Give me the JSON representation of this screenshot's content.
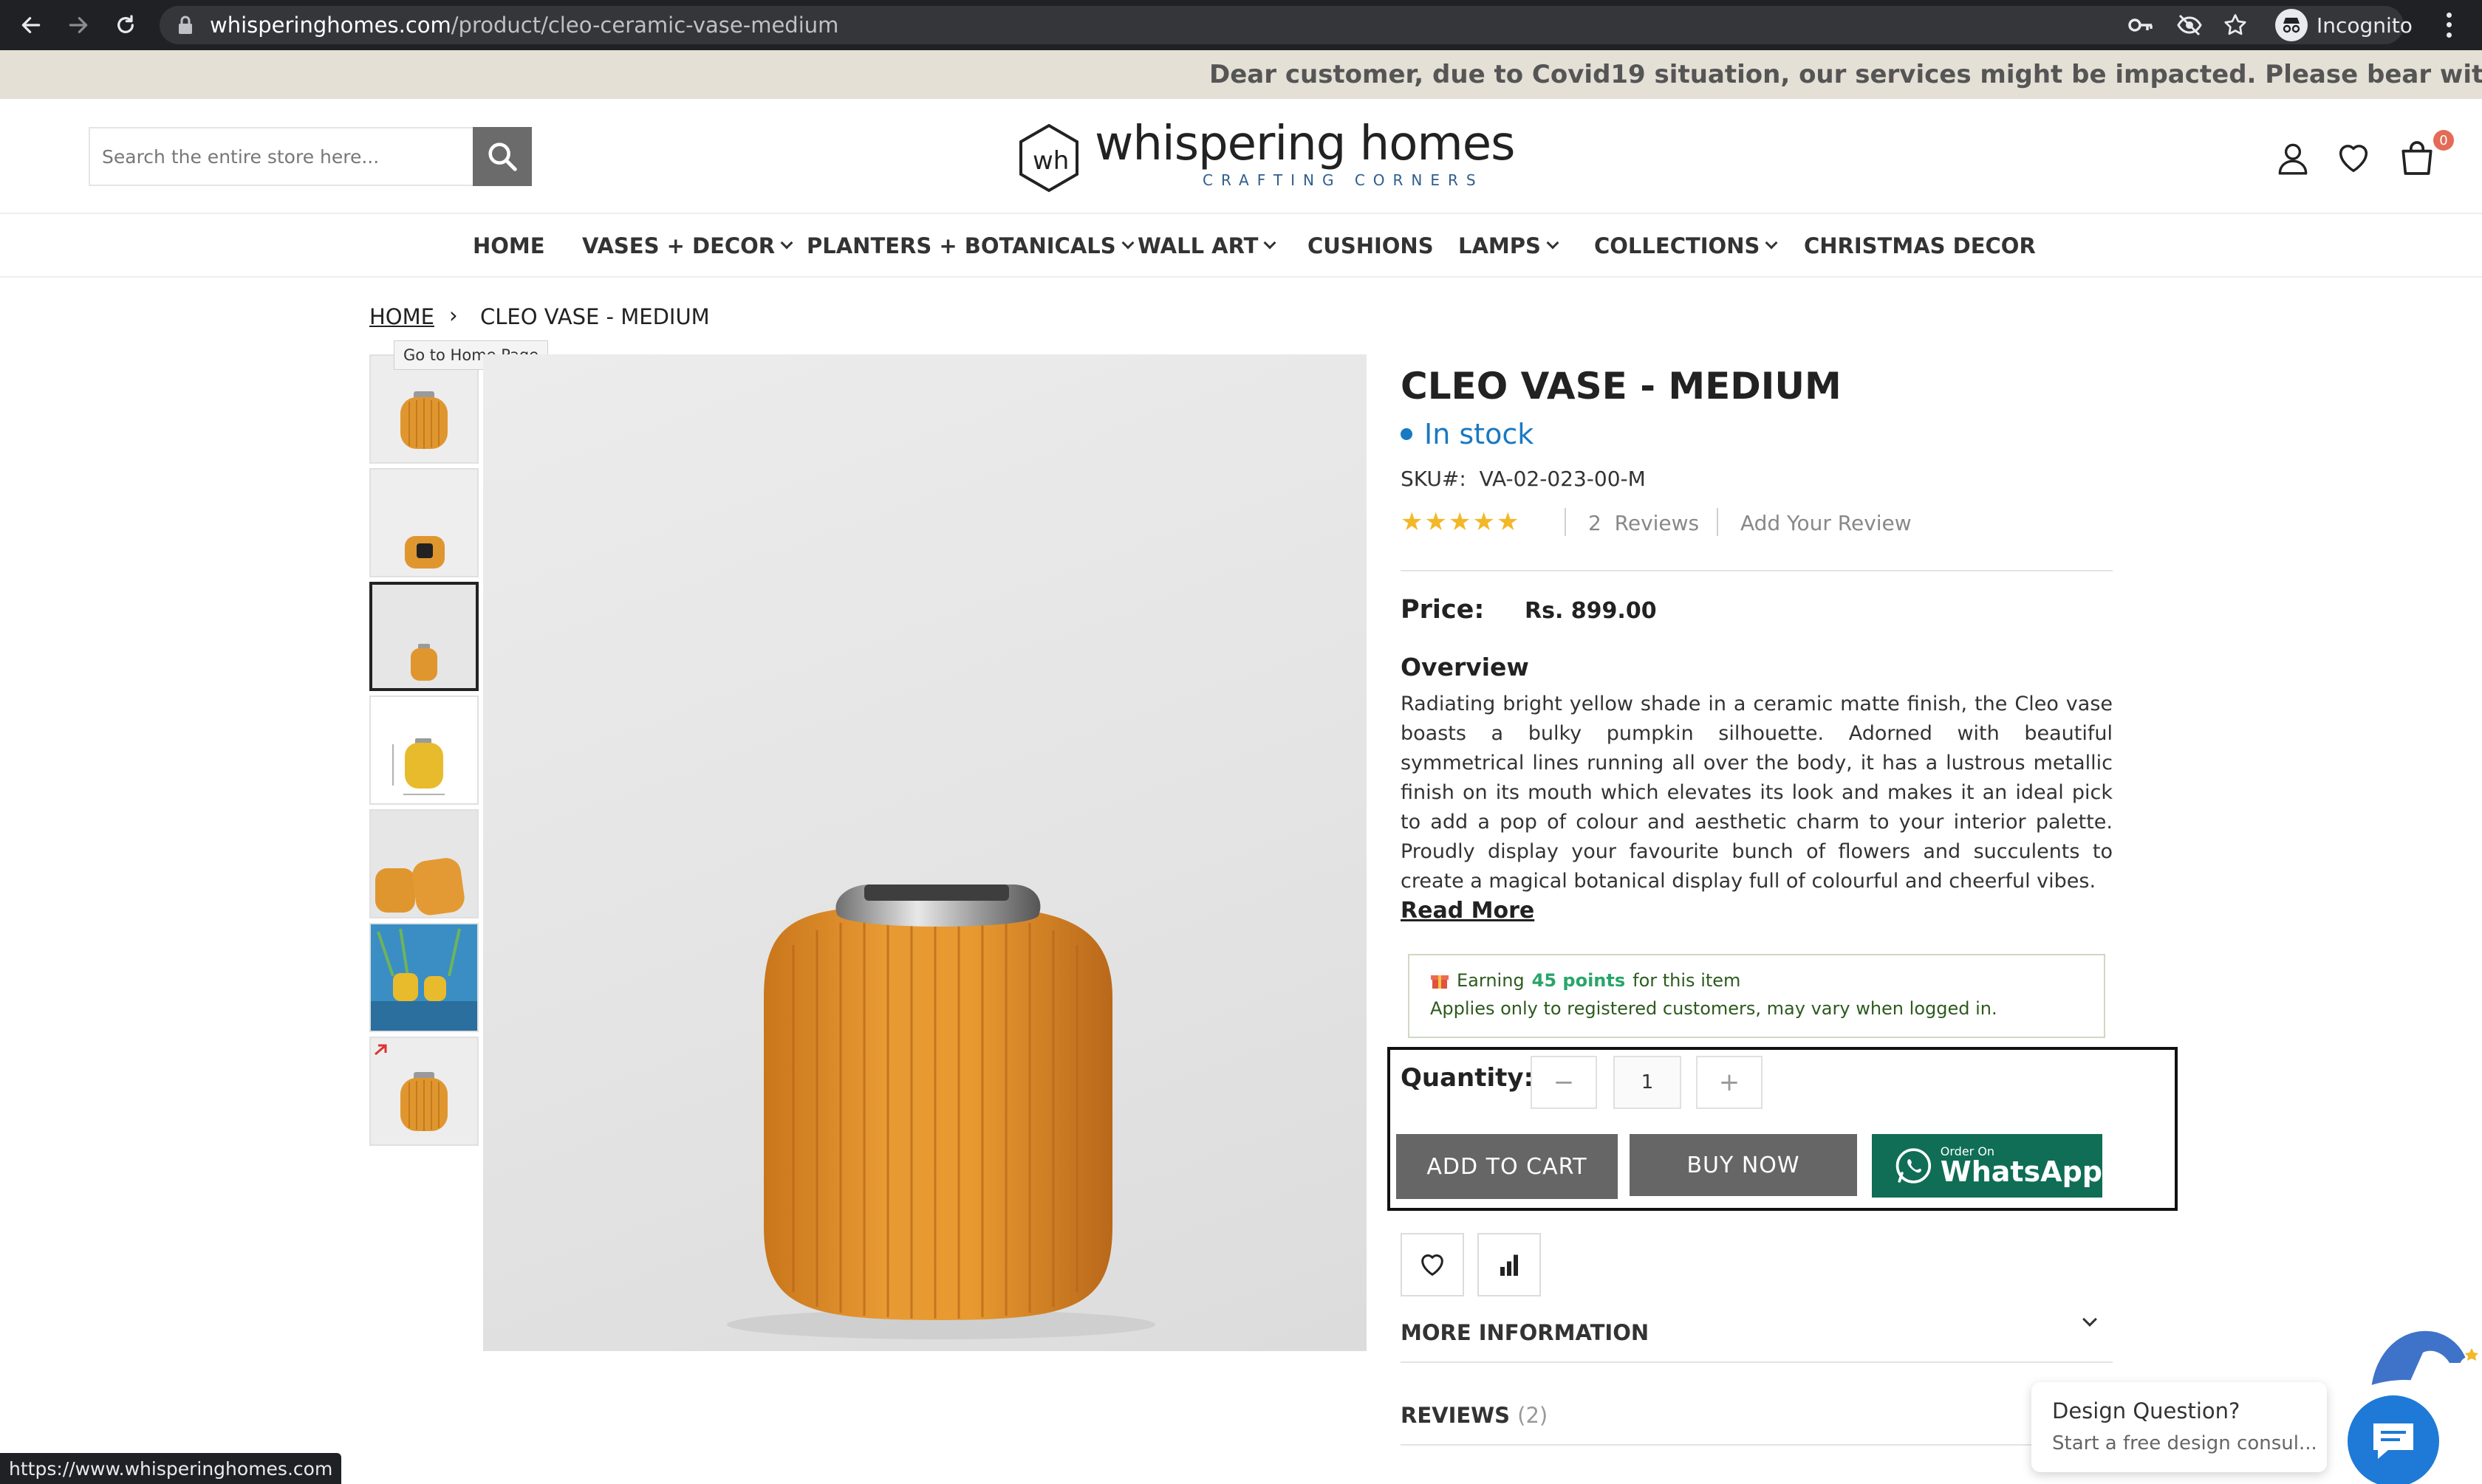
{
  "browser": {
    "url_host": "whisperinghomes.com",
    "url_path": "/product/cleo-ceramic-vase-medium",
    "profile_label": "Incognito"
  },
  "notice": {
    "text": "Dear customer, due to Covid19 situation, our services might be impacted. Please bear with us in these"
  },
  "header": {
    "search_placeholder": "Search the entire store here...",
    "logo_name": "whispering homes",
    "logo_tagline": "CRAFTING CORNERS",
    "logo_mark": "wh",
    "cart_count": "0"
  },
  "nav": {
    "items": [
      {
        "label": "HOME",
        "has_dropdown": false
      },
      {
        "label": "VASES + DECOR",
        "has_dropdown": true
      },
      {
        "label": "PLANTERS + BOTANICALS",
        "has_dropdown": true
      },
      {
        "label": "WALL ART",
        "has_dropdown": true
      },
      {
        "label": "CUSHIONS",
        "has_dropdown": false
      },
      {
        "label": "LAMPS",
        "has_dropdown": true
      },
      {
        "label": "COLLECTIONS",
        "has_dropdown": true
      },
      {
        "label": "CHRISTMAS DECOR",
        "has_dropdown": false
      }
    ]
  },
  "breadcrumb": {
    "home": "HOME",
    "separator": "›",
    "current": "CLEO VASE - MEDIUM",
    "tooltip": "Go to Home Page"
  },
  "product": {
    "title": "CLEO VASE - MEDIUM",
    "stock": "In stock",
    "sku_label": "SKU#:",
    "sku": "VA-02-023-00-M",
    "rating_stars": 5,
    "reviews_count": "2",
    "reviews_label": "Reviews",
    "add_review": "Add Your Review",
    "price_label": "Price:",
    "price": "Rs. 899.00",
    "overview_heading": "Overview",
    "overview_text": "Radiating bright yellow shade in a ceramic matte finish, the Cleo vase boasts a bulky pumpkin silhouette. Adorned with beautiful symmetrical lines running all over the body, it has a lustrous metallic finish on its mouth which elevates its look and makes it an ideal pick to add a pop of colour and aesthetic charm to your interior palette. Proudly display your favourite bunch of flowers and succulents to create a magical botanical display full of colourful and cheerful vibes.",
    "read_more": "Read More",
    "points": {
      "prefix": "Earning",
      "points": "45 points",
      "suffix": "for this item",
      "note": "Applies only to registered customers, may vary when logged in."
    },
    "quantity_label": "Quantity:",
    "quantity_value": "1",
    "minus": "−",
    "plus": "+",
    "add_to_cart": "ADD TO CART",
    "buy_now": "BUY NOW",
    "whatsapp_small": "Order On",
    "whatsapp_big": "WhatsApp",
    "more_information": "MORE INFORMATION",
    "reviews_tab": "REVIEWS",
    "reviews_tab_count": "(2)"
  },
  "chat": {
    "title": "Design Question?",
    "subtitle": "Start a free design consul..."
  },
  "status_bar": {
    "url": "https://www.whisperinghomes.com"
  },
  "colors": {
    "accent_blue": "#1979c3",
    "button_gray": "#666666",
    "whatsapp_green": "#0f6e55",
    "star_yellow": "#f3b728",
    "vase_orange": "#e0962e",
    "notice_bg": "#e4e0d6"
  },
  "icons": {
    "back": "arrow-left-icon",
    "forward": "arrow-right-icon",
    "reload": "reload-icon",
    "lock": "lock-icon",
    "key": "key-icon",
    "eye_off": "eye-off-icon",
    "bookmark": "star-icon",
    "menu": "kebab-menu-icon",
    "search": "search-icon",
    "account": "user-icon",
    "wishlist": "heart-icon",
    "cart": "shopping-bag-icon",
    "compare": "bar-chart-icon",
    "chat": "chat-bubble-icon",
    "gift": "gift-icon"
  }
}
